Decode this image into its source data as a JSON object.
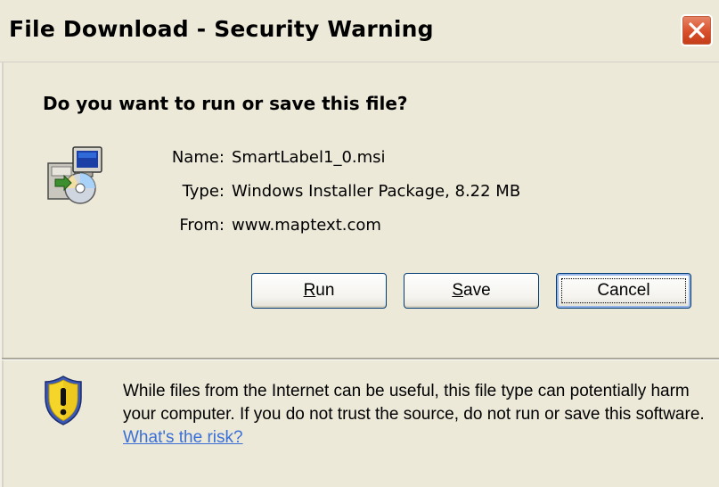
{
  "window": {
    "title": "File Download - Security Warning"
  },
  "prompt": {
    "question": "Do you want to run or save this file?"
  },
  "file": {
    "name_label": "Name:",
    "name_value": "SmartLabel1_0.msi",
    "type_label": "Type:",
    "type_value": "Windows Installer Package, 8.22 MB",
    "from_label": "From:",
    "from_value": "www.maptext.com"
  },
  "buttons": {
    "run_prefix": "",
    "run_accel": "R",
    "run_rest": "un",
    "save_accel": "S",
    "save_rest": "ave",
    "cancel_label": "Cancel"
  },
  "warning": {
    "text": "While files from the Internet can be useful, this file type can potentially harm your computer. If you do not trust the source, do not run or save this software. ",
    "link_text": "What's the risk?"
  },
  "icons": {
    "close": "close-icon",
    "app": "installer-package-icon",
    "warning": "security-shield-icon"
  },
  "colors": {
    "dialog_bg": "#ece9d8",
    "close_button": "#d94f2b",
    "link": "#3a6fd8",
    "button_border": "#003c74"
  }
}
